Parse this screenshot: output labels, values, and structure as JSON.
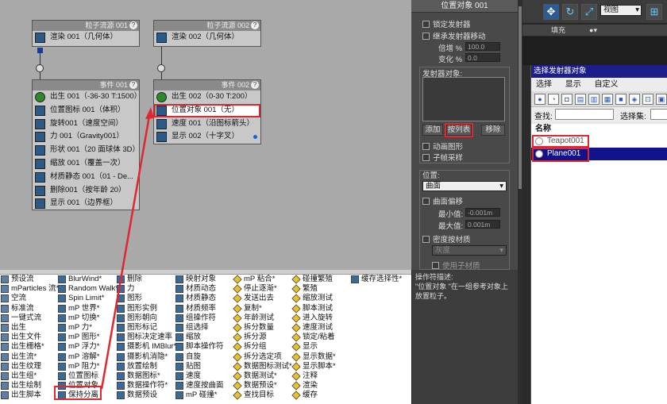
{
  "flow1": {
    "title": "粒子流源 001",
    "ops": [
      {
        "label": "渲染 001（几何体）"
      }
    ]
  },
  "event1": {
    "title": "事件 001",
    "ops": [
      {
        "label": "出生 001（-36-30 T:1500）"
      },
      {
        "label": "位置图标 001（体积）"
      },
      {
        "label": "旋转001（速度空间）"
      },
      {
        "label": "力 001（Gravity001）"
      },
      {
        "label": "形状 001（20 面球体 3D）"
      },
      {
        "label": "缩放 001（覆盖一次）"
      },
      {
        "label": "材质静态 001（01 - De..."
      },
      {
        "label": "删除001（按年龄 20）"
      },
      {
        "label": "显示 001（边界框）"
      }
    ]
  },
  "flow2": {
    "title": "粒子流源 002",
    "ops": [
      {
        "label": "渲染 002（几何体）"
      }
    ]
  },
  "event2": {
    "title": "事件 002",
    "ops": [
      {
        "label": "出生 002（0-30 T:200）"
      },
      {
        "label": "位置对象 001（无）"
      },
      {
        "label": "速度 001（沿图标箭头）"
      },
      {
        "label": "显示 002（十字叉）"
      }
    ]
  },
  "props": {
    "header": "位置对象 001",
    "lock_emitter": "锁定发射器",
    "inherit_motion": "继承发射器移动",
    "multiplier_label": "倍增 %",
    "multiplier_value": "100.0",
    "variation_label": "变化 %",
    "variation_value": "0.0",
    "emitter_objects_label": "发射器对象:",
    "add_button": "添加",
    "by_list_button": "按列表",
    "remove_button": "移除",
    "animated_shape": "动画图形",
    "subframe_sampling": "子帧采样",
    "location_label": "位置:",
    "location_value": "曲面",
    "surface_offset": "曲面偏移",
    "min_label": "最小值:",
    "min_value": "-0.001m",
    "max_label": "最大值:",
    "max_value": "0.001m",
    "density_by_material": "密度按材质",
    "grayscale_value": "灰度",
    "use_sub_material": "使用子材质"
  },
  "description": {
    "title": "操作符描述:",
    "text": "\"位置对象 \"在一组参考对象上放置粒子。"
  },
  "toolbar": {
    "view_value": "视图",
    "strip_label": "填充"
  },
  "dialog": {
    "title": "选择发射器对象",
    "menu": [
      "选择",
      "显示",
      "自定义"
    ],
    "find_label": "查找:",
    "selection_set_label": "选择集:",
    "column_header": "名称",
    "items": [
      "Teapot001",
      "Plane001"
    ]
  },
  "depot": {
    "col1": [
      "预设流",
      "mParticles 流*",
      "空流",
      "标准流",
      "一键式流",
      "出生",
      "出生文件",
      "出生栅格*",
      "出生流*",
      "出生纹理",
      "出生组*",
      "出生绘制",
      "出生脚本"
    ],
    "col2": [
      "BlurWind*",
      "Random Walk*",
      "Spin Limit*",
      "mP 世界*",
      "mP 切换*",
      "mP 力*",
      "mP 图形*",
      "mP 浮力*",
      "mP 溶解*",
      "mP 阻力*",
      "位置图标",
      "位置对象",
      "保持分离"
    ],
    "col3": [
      "删除",
      "力",
      "图形",
      "图形实例",
      "图形朝向",
      "图形标记",
      "图标决定速率",
      "摄影机 IMBlur*",
      "摄影机消隐*",
      "放置绘制",
      "数据图标*",
      "数据操作符*",
      "数据预设"
    ],
    "col4": [
      "映射对象",
      "材质动态",
      "材质静态",
      "材质频率",
      "组操作符",
      "组选择",
      "缩放",
      "脚本操作符",
      "自旋",
      "贴图",
      "速度",
      "速度按曲面",
      "mP 碰撞*"
    ],
    "col5": [
      "mP 粘合*",
      "停止逐渐*",
      "发送出去",
      "复制*",
      "年龄测试",
      "拆分数量",
      "拆分源",
      "拆分组",
      "拆分选定项",
      "数据图标测试*",
      "数据测试*",
      "数据预设*",
      "查找目标"
    ],
    "col6": [
      "碰撞繁殖",
      "繁殖",
      "缩放测试",
      "脚本测试",
      "进入旋转",
      "速度测试",
      "锁定/粘着",
      "显示",
      "显示数据*",
      "显示脚本*",
      "注释",
      "渲染",
      "缓存"
    ],
    "col7": [
      "缓存选择性*"
    ]
  },
  "colors": {
    "highlight_red": "#e0262f",
    "selection_blue": "#12128a",
    "dialog_title": "#1e1e8a"
  }
}
